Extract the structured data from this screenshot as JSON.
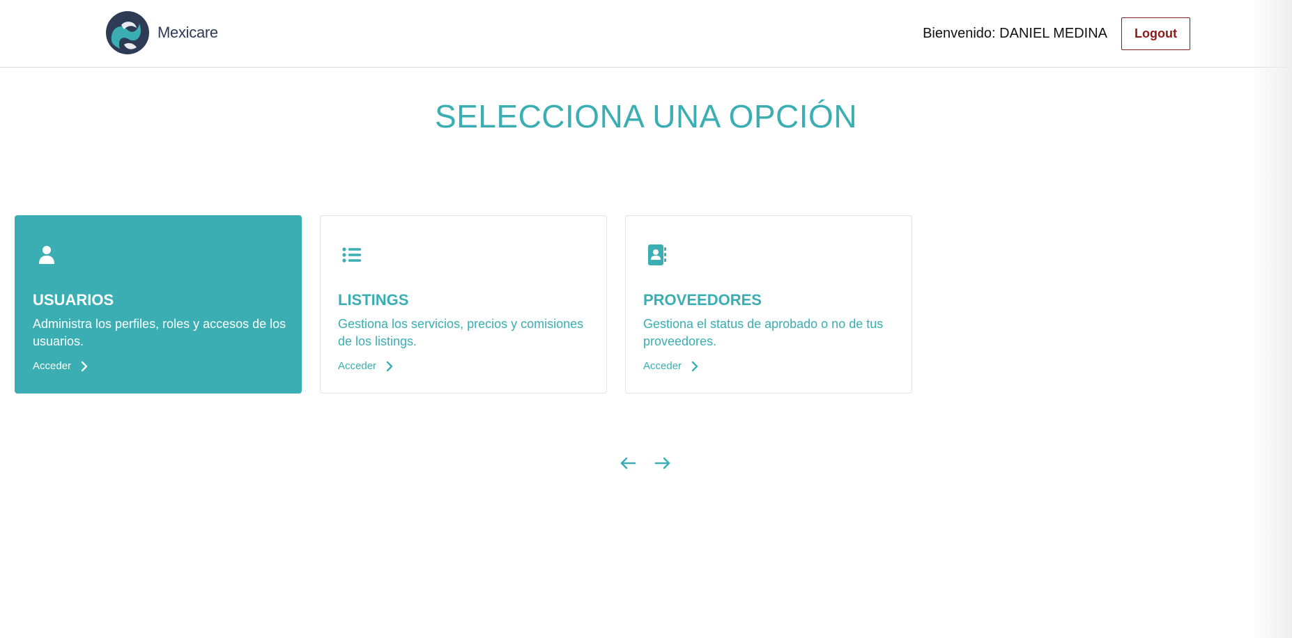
{
  "header": {
    "brand": "Mexicare",
    "welcome": "Bienvenido: DANIEL MEDINA",
    "logout_label": "Logout"
  },
  "main": {
    "title": "SELECCIONA UNA OPCIÓN",
    "cards": [
      {
        "icon": "user-icon",
        "title": "USUARIOS",
        "description": "Administra los perfiles, roles y accesos de los usuarios.",
        "link": "Acceder",
        "active": true
      },
      {
        "icon": "list-icon",
        "title": "LISTINGS",
        "description": "Gestiona los servicios, precios y comisiones de los listings.",
        "link": "Acceder",
        "active": false
      },
      {
        "icon": "address-book-icon",
        "title": "PROVEEDORES",
        "description": "Gestiona el status de aprobado o no de tus proveedores.",
        "link": "Acceder",
        "active": false
      }
    ]
  },
  "colors": {
    "accent": "#3aaeb3",
    "logout": "#8b1a1a",
    "brand_dark": "#2d3b55"
  }
}
